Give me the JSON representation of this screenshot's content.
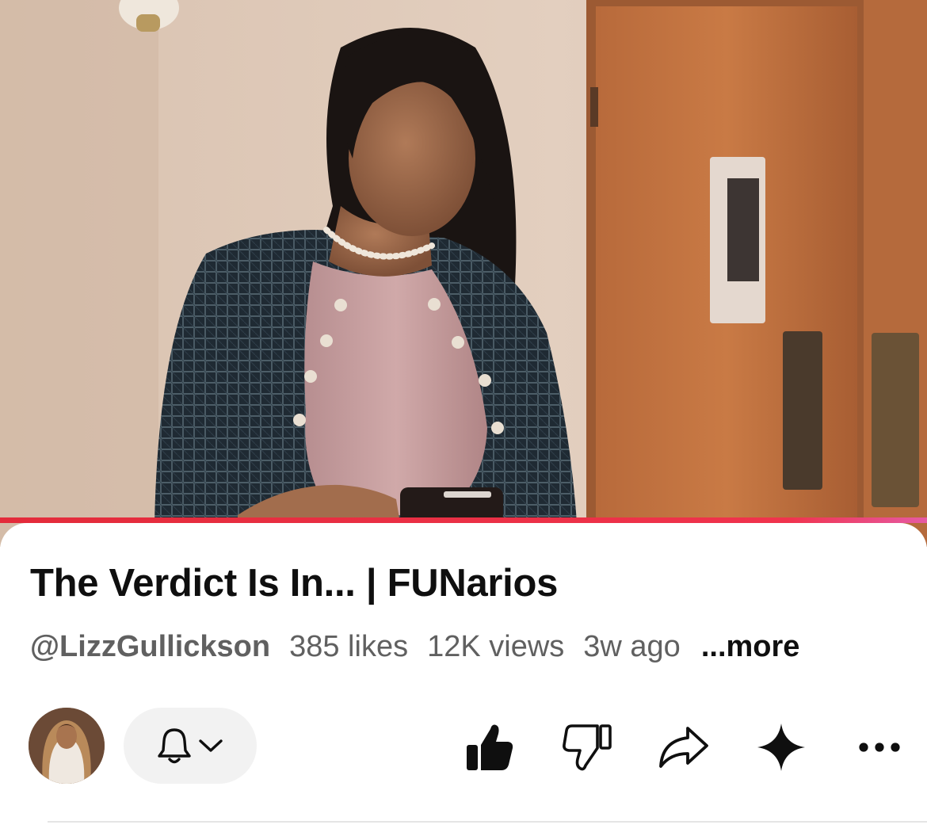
{
  "video": {
    "progress_fraction": 1.0,
    "progress_color": "#f0334d"
  },
  "info": {
    "title": "The Verdict Is In... | FUNarios",
    "channel": "@LizzGullickson",
    "likes": "385 likes",
    "views": "12K views",
    "age": "3w ago",
    "more_label": "...more"
  },
  "actions": {
    "avatar_icon": "channel-avatar",
    "bell_icon": "bell-icon",
    "chevron_icon": "chevron-down-icon",
    "like_icon": "thumbs-up-filled-icon",
    "dislike_icon": "thumbs-down-icon",
    "share_icon": "share-arrow-icon",
    "ai_icon": "sparkle-icon",
    "more_icon": "more-horizontal-icon"
  }
}
